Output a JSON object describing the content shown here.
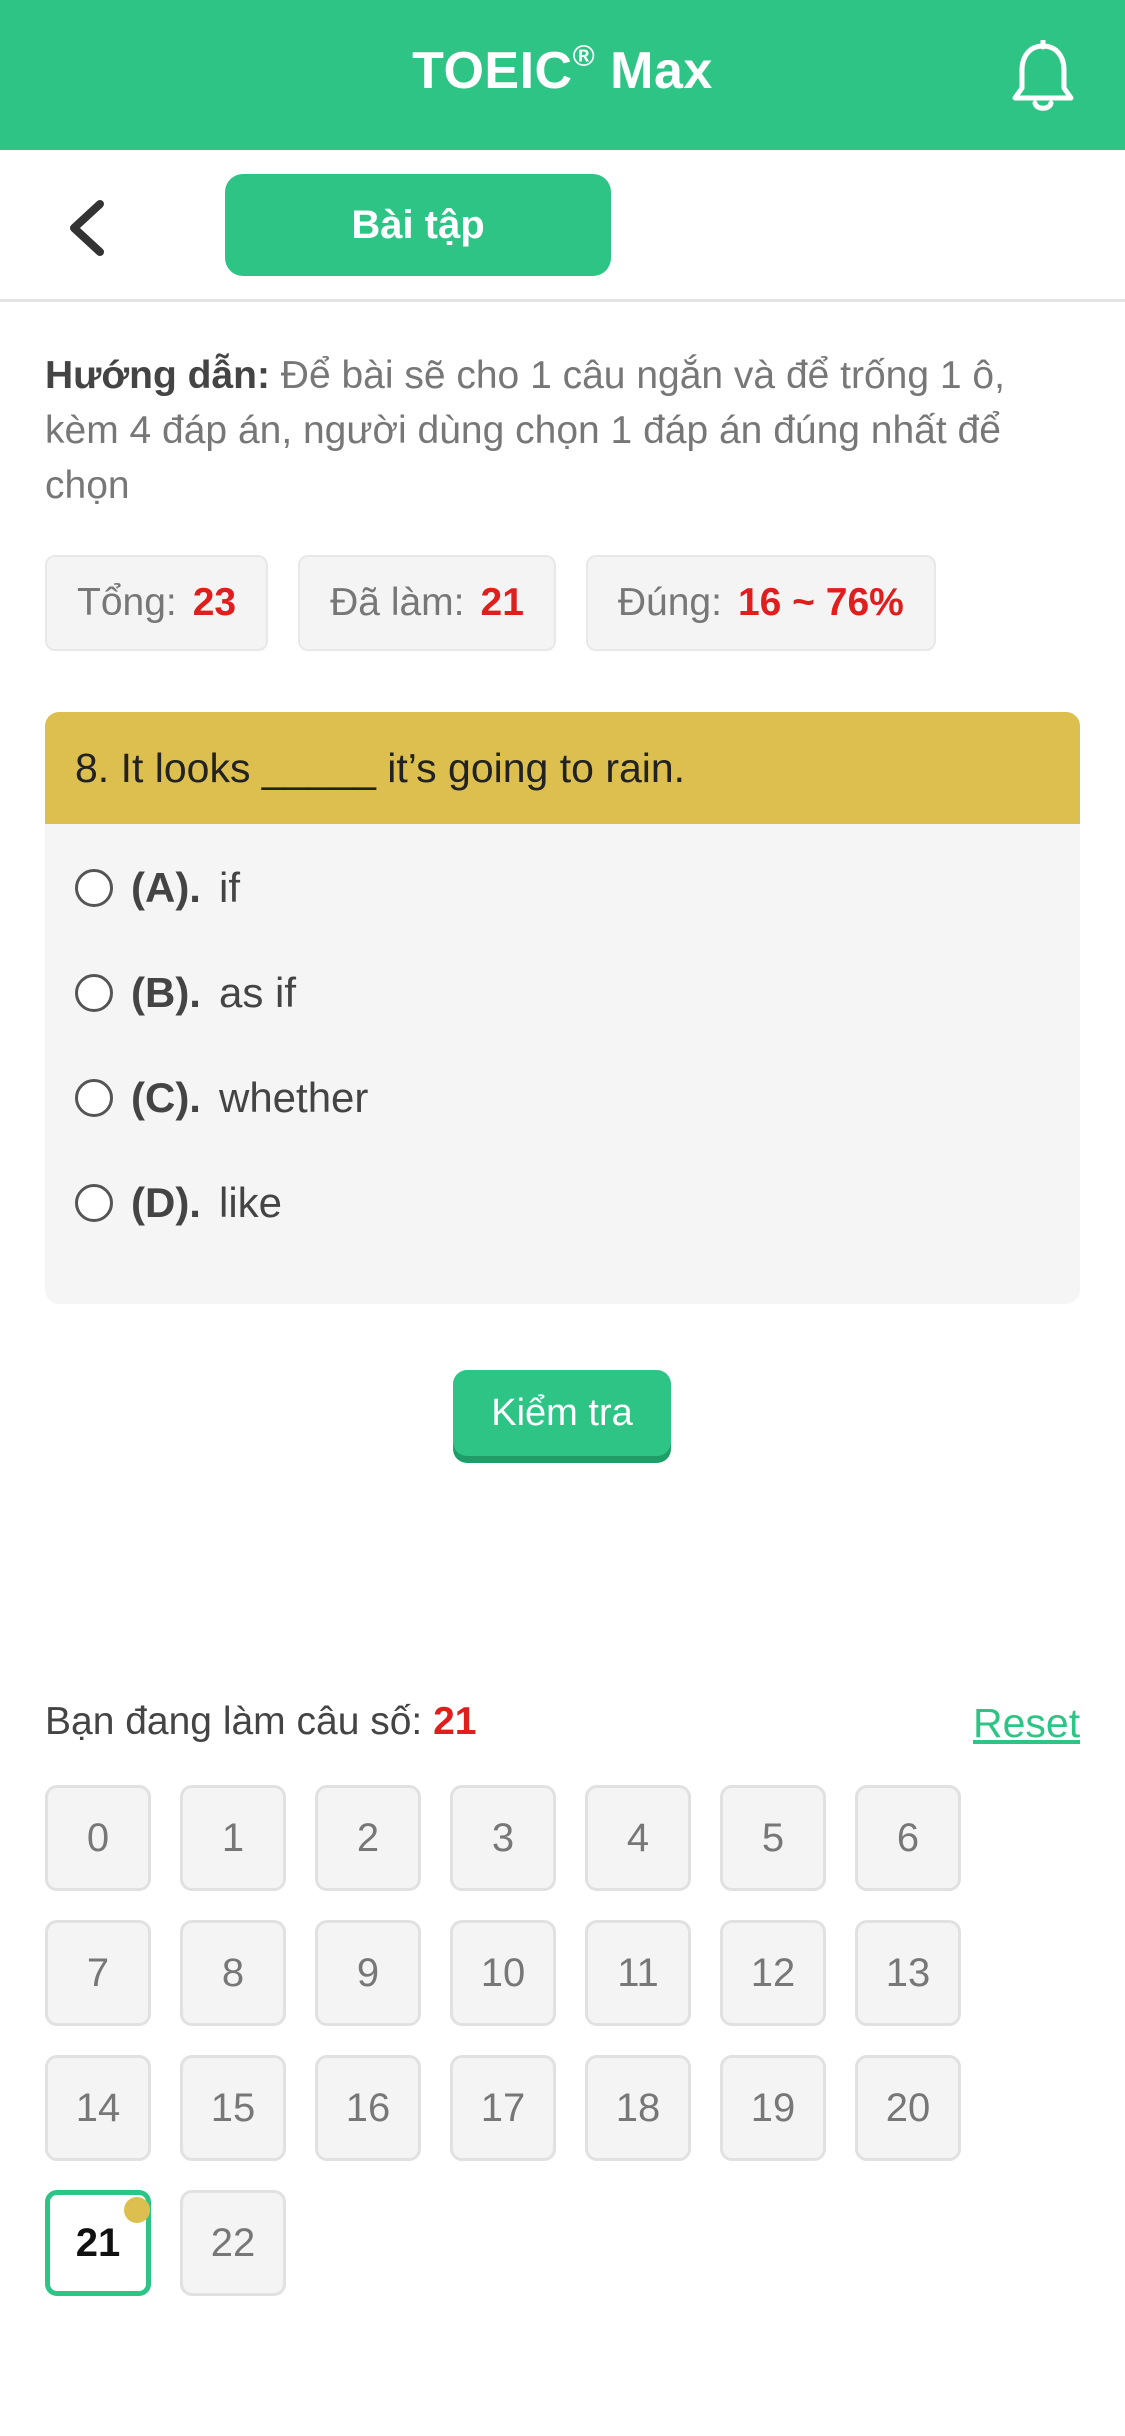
{
  "header": {
    "title": "TOEIC",
    "title_sup": "®",
    "title_suffix": " Max"
  },
  "subbar": {
    "tab_label": "Bài tập"
  },
  "guide": {
    "label": "Hướng dẫn:",
    "text": " Để bài sẽ cho 1 câu ngắn và để trống 1 ô, kèm 4 đáp án, người dùng chọn 1 đáp án đúng nhất để chọn"
  },
  "stats": [
    {
      "label": "Tổng:",
      "value": "23"
    },
    {
      "label": "Đã làm:",
      "value": "21"
    },
    {
      "label": "Đúng:",
      "value": "16 ~ 76%"
    }
  ],
  "question": {
    "text": "8. It looks _____ it’s going to rain.",
    "options": [
      {
        "label": "(A).",
        "text": "if"
      },
      {
        "label": "(B).",
        "text": "as if"
      },
      {
        "label": "(C).",
        "text": "whether"
      },
      {
        "label": "(D).",
        "text": "like"
      }
    ]
  },
  "actions": {
    "check_label": "Kiểm tra",
    "reset_label": "Reset"
  },
  "progress": {
    "current_label": "Bạn đang làm câu số:",
    "current_value": "21",
    "numbers": [
      "0",
      "1",
      "2",
      "3",
      "4",
      "5",
      "6",
      "7",
      "8",
      "9",
      "10",
      "11",
      "12",
      "13",
      "14",
      "15",
      "16",
      "17",
      "18",
      "19",
      "20",
      "21",
      "22"
    ],
    "active": "21"
  },
  "colors": {
    "primary": "#2ec486",
    "accent": "#dcbf4f",
    "highlight": "#e01e1e"
  },
  "icons": {
    "header_right": "bell-icon",
    "back": "chevron-left-icon"
  }
}
